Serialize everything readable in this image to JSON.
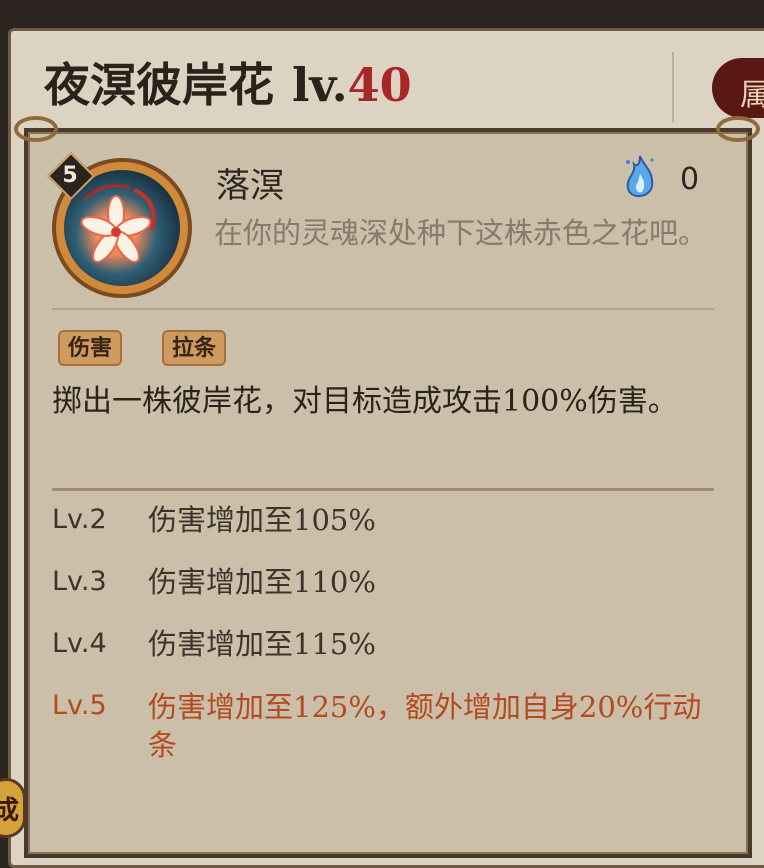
{
  "header": {
    "shikigami_name": "夜溟彼岸花",
    "level_prefix": "lv.",
    "level_value": "40",
    "side_tab_char": "属"
  },
  "corner_badge_char": "成",
  "skill": {
    "level_badge": "5",
    "name": "落溟",
    "orb_cost": "0",
    "flavor_text": "在你的灵魂深处种下这株赤色之花吧。",
    "tags": [
      "伤害",
      "拉条"
    ],
    "description": "掷出一株彼岸花，对目标造成攻击100%伤害。",
    "icons": {
      "skill": "spider-lily-icon",
      "cost": "blue-soul-flame-icon"
    }
  },
  "upgrades": [
    {
      "level": "Lv.2",
      "effect": "伤害增加至105%",
      "highlighted": false
    },
    {
      "level": "Lv.3",
      "effect": "伤害增加至110%",
      "highlighted": false
    },
    {
      "level": "Lv.4",
      "effect": "伤害增加至115%",
      "highlighted": false
    },
    {
      "level": "Lv.5",
      "effect": "伤害增加至125%，额外增加自身20%行动条",
      "highlighted": true
    }
  ],
  "colors": {
    "level_number": "#a8262a",
    "highlight_text": "#b24a22",
    "parchment": "#cbbfa9",
    "tag_bg": "#cf9a60"
  }
}
